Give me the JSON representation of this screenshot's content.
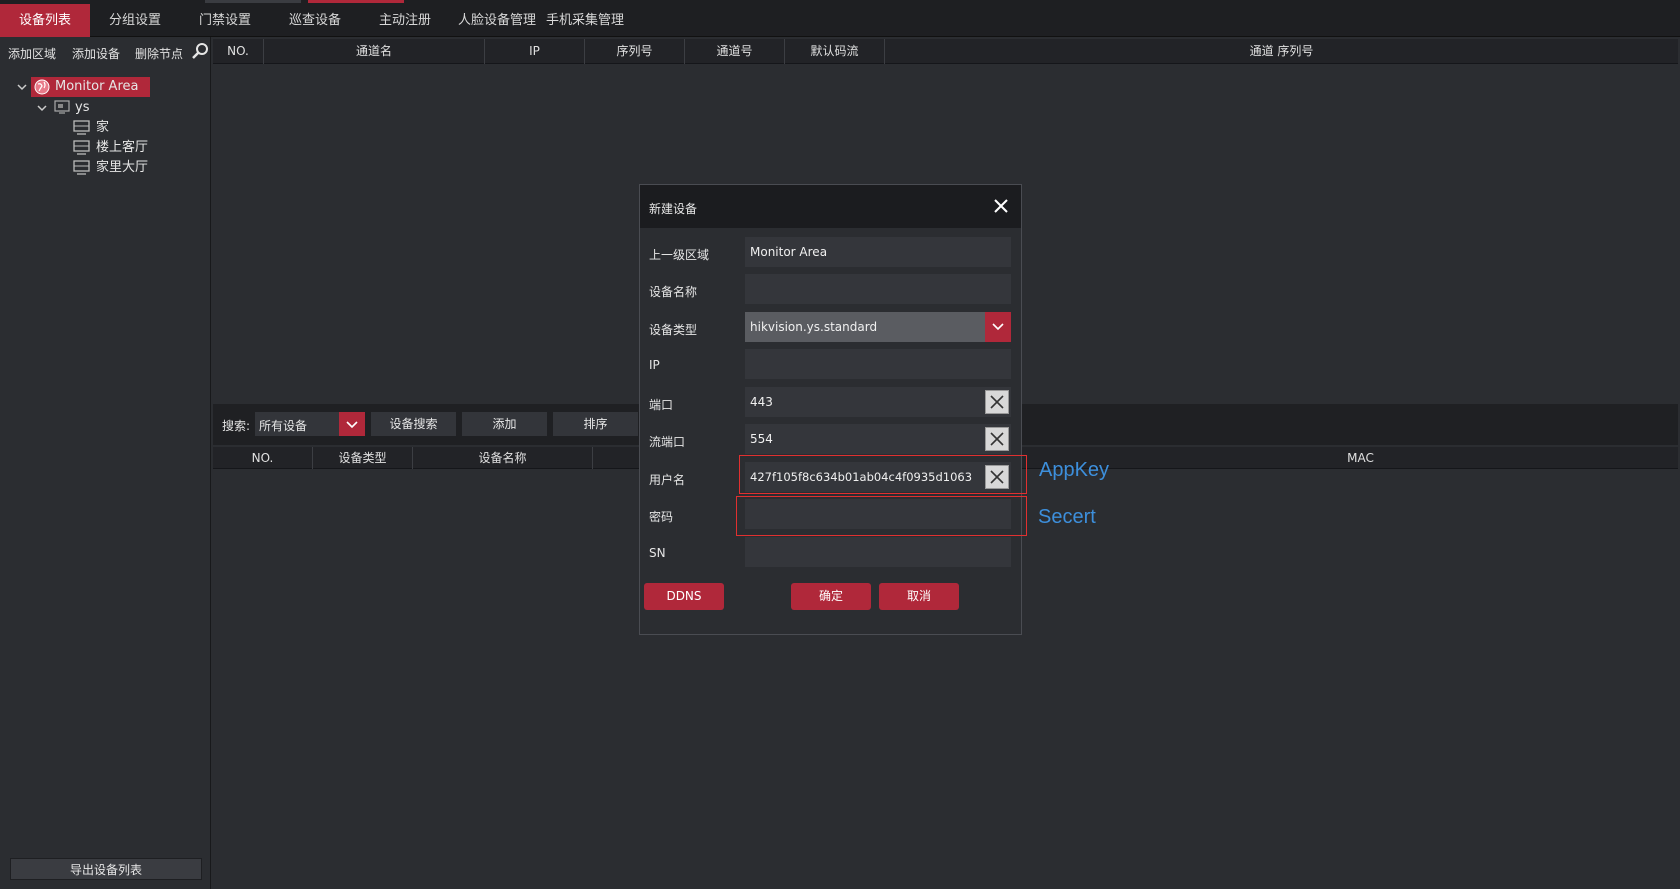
{
  "top_tabs": [
    {
      "label": "设备列表"
    },
    {
      "label": "分组设置"
    },
    {
      "label": "门禁设置"
    },
    {
      "label": "巡查设备"
    },
    {
      "label": "主动注册"
    },
    {
      "label": "人脸设备管理"
    },
    {
      "label": "手机采集管理"
    }
  ],
  "left_toolbar": {
    "add_area": "添加区域",
    "add_device": "添加设备",
    "delete_node": "删除节点"
  },
  "tree": {
    "root": "Monitor Area",
    "device": "ys",
    "channels": [
      "家",
      "楼上客厅",
      "家里大厅"
    ]
  },
  "export_button": "导出设备列表",
  "channel_table": {
    "headers": [
      "NO.",
      "通道名",
      "IP",
      "序列号",
      "通道号",
      "默认码流",
      "通道 序列号"
    ]
  },
  "search_bar": {
    "label": "搜索:",
    "filter_value": "所有设备",
    "device_search": "设备搜索",
    "add": "添加",
    "sort": "排序"
  },
  "device_table": {
    "headers": [
      "NO.",
      "设备类型",
      "设备名称",
      "MAC"
    ]
  },
  "dialog": {
    "title": "新建设备",
    "fields": {
      "parent_area": {
        "label": "上一级区域",
        "value": "Monitor Area"
      },
      "device_name": {
        "label": "设备名称",
        "value": ""
      },
      "device_type": {
        "label": "设备类型",
        "value": "hikvision.ys.standard"
      },
      "ip": {
        "label": "IP",
        "value": ""
      },
      "port": {
        "label": "端口",
        "value": "443"
      },
      "stream_port": {
        "label": "流端口",
        "value": "554"
      },
      "username": {
        "label": "用户名",
        "value": "427f105f8c634b01ab04c4f0935d1063"
      },
      "password": {
        "label": "密码",
        "value": ""
      },
      "sn": {
        "label": "SN",
        "value": ""
      }
    },
    "buttons": {
      "ddns": "DDNS",
      "ok": "确定",
      "cancel": "取消"
    }
  },
  "annotations": {
    "appkey": "AppKey",
    "secret": "Secert"
  },
  "colors": {
    "accent": "#b0283a",
    "annotation_box": "#e03030",
    "annotation_text": "#3d8fdc"
  }
}
